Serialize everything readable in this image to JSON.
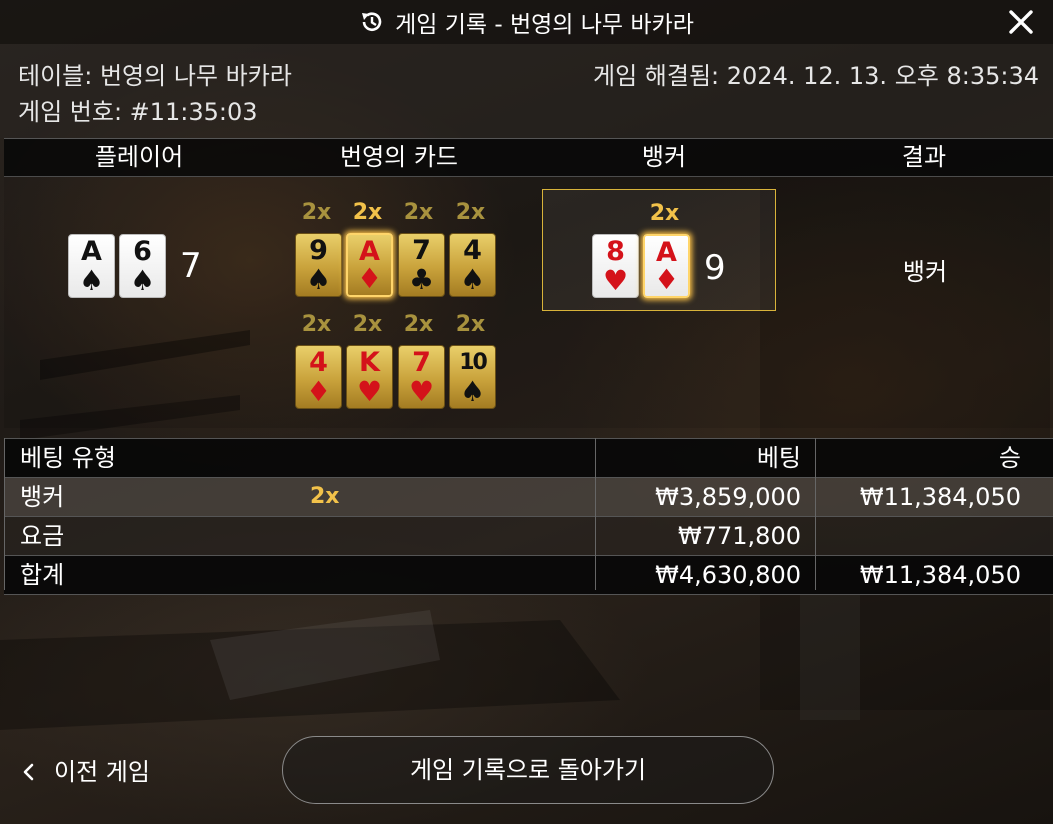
{
  "header": {
    "title": "게임 기록 - 번영의 나무 바카라"
  },
  "info": {
    "table_label": "테이블: 번영의 나무 바카라",
    "game_number_label": "게임 번호: #11:35:03",
    "resolved_label": "게임 해결됨: 2024. 12. 13. 오후 8:35:34"
  },
  "columns": {
    "player": "플레이어",
    "lucky_cards": "번영의 카드",
    "banker": "뱅커",
    "result": "결과"
  },
  "player": {
    "cards": [
      {
        "rank": "A",
        "suit": "♠"
      },
      {
        "rank": "6",
        "suit": "♠"
      }
    ],
    "score": "7"
  },
  "lucky_cards": [
    {
      "mult": "2x",
      "rank": "9",
      "suit": "♠"
    },
    {
      "mult": "2x",
      "rank": "A",
      "suit": "♦"
    },
    {
      "mult": "2x",
      "rank": "7",
      "suit": "♣"
    },
    {
      "mult": "2x",
      "rank": "4",
      "suit": "♠"
    },
    {
      "mult": "2x",
      "rank": "4",
      "suit": "♦"
    },
    {
      "mult": "2x",
      "rank": "K",
      "suit": "♥"
    },
    {
      "mult": "2x",
      "rank": "7",
      "suit": "♥"
    },
    {
      "mult": "2x",
      "rank": "10",
      "suit": "♠"
    }
  ],
  "banker": {
    "mult": "2x",
    "cards": [
      {
        "rank": "8",
        "suit": "♥"
      },
      {
        "rank": "A",
        "suit": "♦"
      }
    ],
    "score": "9"
  },
  "result": "뱅커",
  "bets": {
    "headers": {
      "type": "베팅 유형",
      "bet": "베팅",
      "win": "승"
    },
    "rows": [
      {
        "type": "뱅커",
        "mult": "2x",
        "bet": "₩3,859,000",
        "win": "₩11,384,050"
      },
      {
        "type": "요금",
        "mult": "",
        "bet": "₩771,800",
        "win": ""
      },
      {
        "type": "합계",
        "mult": "",
        "bet": "₩4,630,800",
        "win": "₩11,384,050"
      }
    ]
  },
  "footer": {
    "prev_game": "이전 게임",
    "back_to_history": "게임 기록으로 돌아가기"
  },
  "colors": {
    "gold_accent": "#d8b33a",
    "card_red": "#d4121a",
    "multiplier": "#f2c24a"
  }
}
